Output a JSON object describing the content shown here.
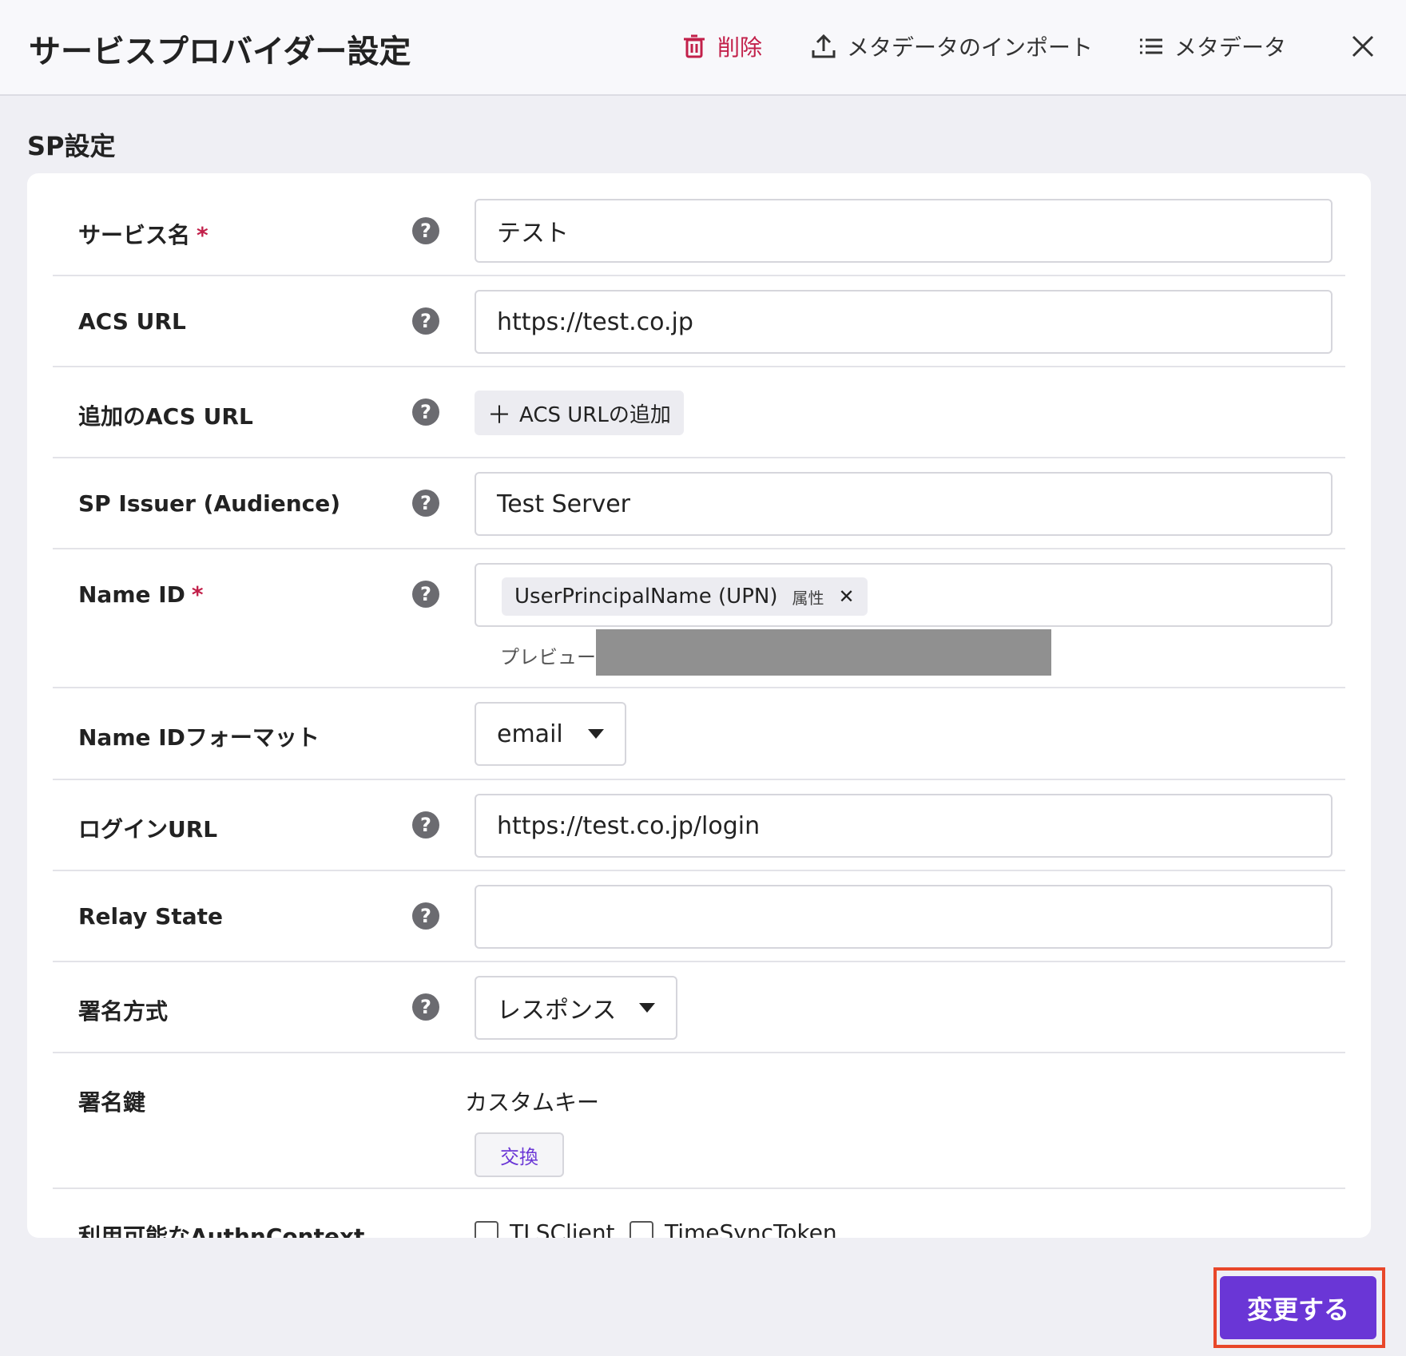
{
  "header": {
    "title": "サービスプロバイダー設定",
    "delete_label": "削除",
    "import_label": "メタデータのインポート",
    "metadata_label": "メタデータ"
  },
  "section": {
    "title": "SP設定"
  },
  "fields": {
    "service_name": {
      "label": "サービス名",
      "required": "*",
      "value": "テスト"
    },
    "acs_url": {
      "label": "ACS URL",
      "value": "https://test.co.jp"
    },
    "additional_acs": {
      "label": "追加のACS URL",
      "button": "ACS URLの追加"
    },
    "sp_issuer": {
      "label": "SP Issuer (Audience)",
      "value": "Test Server"
    },
    "name_id": {
      "label": "Name ID",
      "required": "*",
      "chip": "UserPrincipalName (UPN)",
      "chip_sub": "属性",
      "preview_label": "プレビュー:"
    },
    "name_id_format": {
      "label": "Name IDフォーマット",
      "value": "email"
    },
    "login_url": {
      "label": "ログインURL",
      "value": "https://test.co.jp/login"
    },
    "relay_state": {
      "label": "Relay State",
      "value": ""
    },
    "sign_method": {
      "label": "署名方式",
      "value": "レスポンス"
    },
    "sign_key": {
      "label": "署名鍵",
      "value": "カスタムキー",
      "button": "交換"
    },
    "authn_context": {
      "label": "利用可能なAuthnContext",
      "options": [
        "TLSClient",
        "TimeSyncToken"
      ]
    }
  },
  "footer": {
    "submit_label": "変更する"
  },
  "colors": {
    "accent": "#6a36d6",
    "danger": "#c2204a",
    "highlight": "#e8472a"
  }
}
